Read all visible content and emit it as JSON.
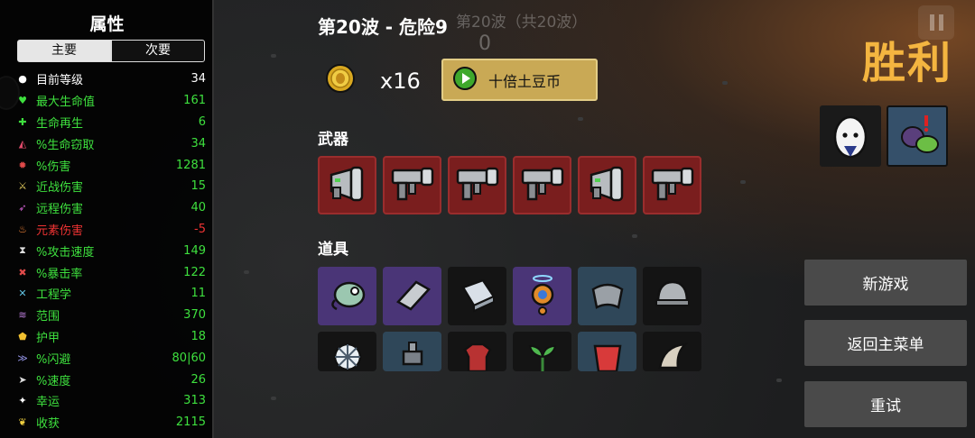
{
  "stats_panel": {
    "title": "属性",
    "tabs": [
      "主要",
      "次要"
    ],
    "rows": [
      {
        "icon": "level-icon",
        "name": "目前等级",
        "value": "34",
        "color": "white"
      },
      {
        "icon": "heart-icon",
        "name": "最大生命值",
        "value": "161",
        "color": "green"
      },
      {
        "icon": "regen-icon",
        "name": "生命再生",
        "value": "6",
        "color": "green"
      },
      {
        "icon": "lifesteal-icon",
        "name": "%生命窃取",
        "value": "34",
        "color": "green"
      },
      {
        "icon": "damage-icon",
        "name": "%伤害",
        "value": "1281",
        "color": "green"
      },
      {
        "icon": "melee-icon",
        "name": "近战伤害",
        "value": "15",
        "color": "green"
      },
      {
        "icon": "ranged-icon",
        "name": "远程伤害",
        "value": "40",
        "color": "green"
      },
      {
        "icon": "elemental-icon",
        "name": "元素伤害",
        "value": "-5",
        "color": "red"
      },
      {
        "icon": "attack-speed-icon",
        "name": "%攻击速度",
        "value": "149",
        "color": "green"
      },
      {
        "icon": "crit-icon",
        "name": "%暴击率",
        "value": "122",
        "color": "green"
      },
      {
        "icon": "engineering-icon",
        "name": "工程学",
        "value": "11",
        "color": "green"
      },
      {
        "icon": "range-icon",
        "name": "范围",
        "value": "370",
        "color": "green"
      },
      {
        "icon": "armor-icon",
        "name": "护甲",
        "value": "18",
        "color": "green"
      },
      {
        "icon": "dodge-icon",
        "name": "%闪避",
        "value": "80|60",
        "color": "green"
      },
      {
        "icon": "speed-icon",
        "name": "%速度",
        "value": "26",
        "color": "green"
      },
      {
        "icon": "luck-icon",
        "name": "幸运",
        "value": "313",
        "color": "green"
      },
      {
        "icon": "harvest-icon",
        "name": "收获",
        "value": "2115",
        "color": "green"
      }
    ]
  },
  "main": {
    "wave_title": "第20波 - 危险9",
    "background_wave_text": "第20波（共20波）",
    "background_counter": "0",
    "coin_count": "x16",
    "gold_button_label": "十倍土豆币",
    "weapons_label": "武器",
    "items_label": "道具",
    "weapons": [
      "megaphone-weapon-icon",
      "smg-weapon-icon",
      "smg-weapon-icon",
      "smg-weapon-icon",
      "megaphone-weapon-icon",
      "smg-weapon-icon"
    ],
    "items_row1": [
      {
        "name": "chameleon-item-icon",
        "tier": "purple"
      },
      {
        "name": "metal-block-item-icon",
        "tier": "purple"
      },
      {
        "name": "book-item-icon",
        "tier": "dark"
      },
      {
        "name": "halo-drone-item-icon",
        "tier": "purple"
      },
      {
        "name": "scarf-item-icon",
        "tier": "blue"
      },
      {
        "name": "helmet-item-icon",
        "tier": "dark"
      }
    ],
    "items_row2": [
      {
        "name": "snowflake-item-icon",
        "tier": "dark"
      },
      {
        "name": "turret-item-icon",
        "tier": "blue"
      },
      {
        "name": "plaid-shirt-item-icon",
        "tier": "dark"
      },
      {
        "name": "sprout-item-icon",
        "tier": "dark"
      },
      {
        "name": "red-cloth-item-icon",
        "tier": "blue"
      },
      {
        "name": "horn-item-icon",
        "tier": "dark"
      }
    ]
  },
  "right": {
    "result_title": "胜利",
    "character_portraits": [
      "egg-character-icon",
      "creature-character-icon"
    ],
    "buttons": [
      "新游戏",
      "返回主菜单",
      "重试"
    ]
  },
  "colors": {
    "victory": "#f4b540",
    "gold_button": "#c9a955",
    "stat_positive": "#3ee03e",
    "stat_negative": "#ee3333",
    "weapon_slot": "#7a1e1e",
    "tier_purple": "#4a3577",
    "tier_blue": "#2f4759"
  }
}
